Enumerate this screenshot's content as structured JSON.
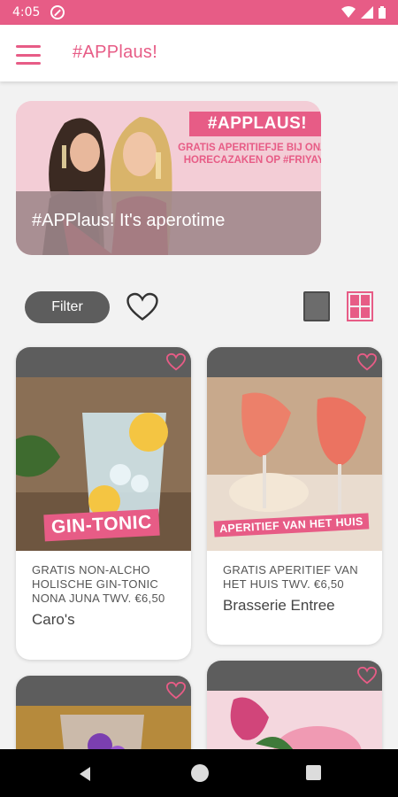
{
  "status_bar": {
    "time": "4:05"
  },
  "app_bar": {
    "title": "#APPlaus!"
  },
  "banner": {
    "pill": "#APPLAUS!",
    "subtitle": "GRATIS APERITIEFJE BIJ ONZE HORECAZAKEN OP #FRIYAY!",
    "caption": "#APPlaus! It's aperotime"
  },
  "filter": {
    "label": "Filter"
  },
  "cards": [
    {
      "tag": "GIN-TONIC",
      "description": "GRATIS NON-ALCHO HOLISCHE GIN-TONIC NONA JUNA TWV. €6,50",
      "venue": "Caro's"
    },
    {
      "tag": "APERITIEF VAN HET HUIS",
      "description": "GRATIS APERITIEF VAN HET HUIS TWV. €6,50",
      "venue": "Brasserie Entree"
    }
  ],
  "colors": {
    "accent": "#e75c86",
    "dark": "#5d5d5d",
    "background": "#f2f2f2"
  }
}
